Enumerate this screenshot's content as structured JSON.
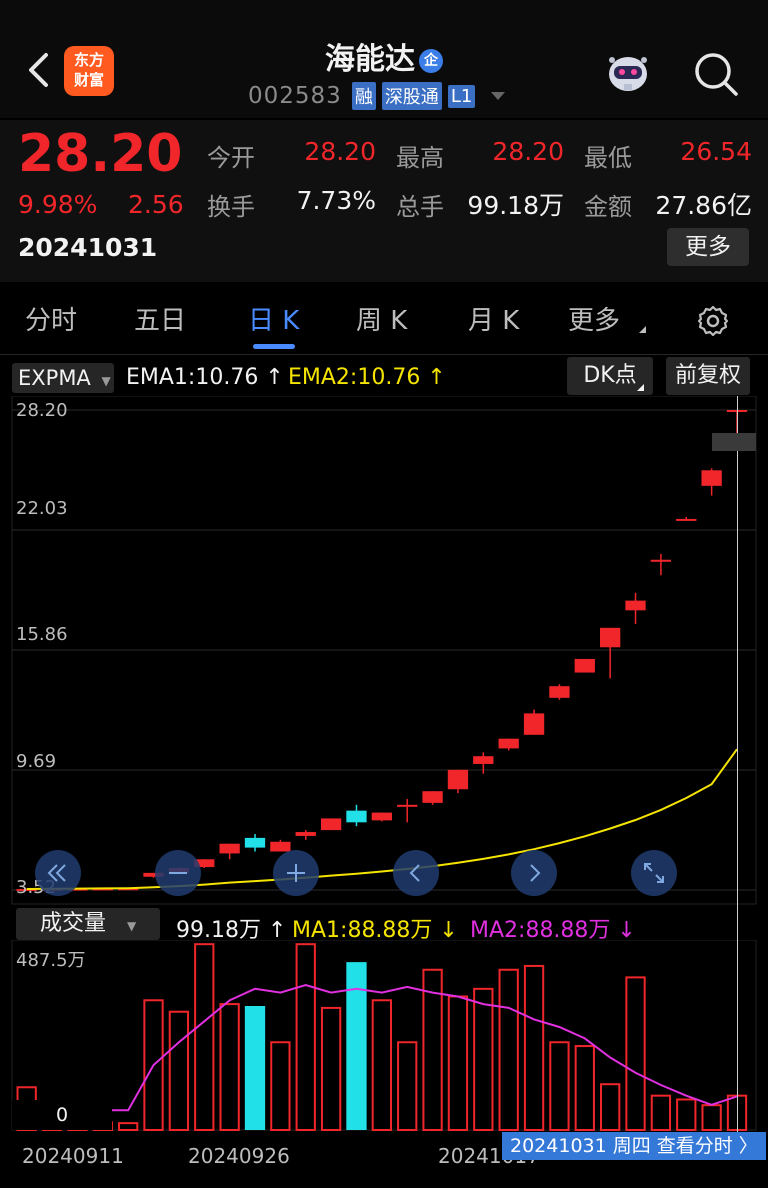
{
  "header": {
    "logo_text_1": "东方",
    "logo_text_2": "财富",
    "stock_name": "海能达",
    "qi_badge": "企",
    "stock_code": "002583",
    "tags": [
      "融",
      "深股通",
      "L1"
    ]
  },
  "quote": {
    "price": "28.20",
    "change_pct": "9.98%",
    "change": "2.56",
    "date": "20241031",
    "fields": [
      {
        "label": "今开",
        "value": "28.20",
        "color": "red"
      },
      {
        "label": "最高",
        "value": "28.20",
        "color": "red"
      },
      {
        "label": "最低",
        "value": "26.54",
        "color": "red"
      },
      {
        "label": "换手",
        "value": "7.73%",
        "color": "white"
      },
      {
        "label": "总手",
        "value": "99.18万",
        "color": "white"
      },
      {
        "label": "金额",
        "value": "27.86亿",
        "color": "white"
      }
    ],
    "more_button": "更多"
  },
  "tabs": [
    "分时",
    "五日",
    "日 K",
    "周 K",
    "月 K",
    "更多"
  ],
  "active_tab": "日 K",
  "kchart": {
    "indicator": "EXPMA",
    "ema1": "EMA1:10.76",
    "ema2": "EMA2:10.76",
    "dk_button": "DK点",
    "adjust_button": "前复权",
    "y_labels": [
      "28.20",
      "22.03",
      "15.86",
      "9.69",
      "3.52"
    ],
    "colors": {
      "up": "#f0262a",
      "down": "#22e0e8",
      "ema2": "#f5e400",
      "ma2": "#e030e0"
    }
  },
  "volume": {
    "indicator": "成交量",
    "vol": "99.18万",
    "ma1": "MA1:88.88万",
    "ma2": "MA2:88.88万",
    "top_label": "487.5万",
    "zero_label": "0"
  },
  "x_labels": [
    "20240911",
    "20240926",
    "20241017"
  ],
  "cursor_tag": "20241031 周四  查看分时",
  "chart_data": {
    "type": "candlestick",
    "ylim": [
      3.52,
      28.2
    ],
    "candles": [
      {
        "o": 3.56,
        "h": 3.58,
        "l": 3.54,
        "c": 3.57
      },
      {
        "o": 3.57,
        "h": 3.6,
        "l": 3.55,
        "c": 3.58
      },
      {
        "o": 3.58,
        "h": 3.6,
        "l": 3.56,
        "c": 3.59
      },
      {
        "o": 3.59,
        "h": 3.62,
        "l": 3.57,
        "c": 3.6
      },
      {
        "o": 3.6,
        "h": 3.62,
        "l": 3.58,
        "c": 3.61
      },
      {
        "o": 4.2,
        "h": 4.4,
        "l": 4.15,
        "c": 4.4
      },
      {
        "o": 4.4,
        "h": 4.7,
        "l": 4.35,
        "c": 4.65
      },
      {
        "o": 4.7,
        "h": 5.1,
        "l": 4.65,
        "c": 5.1
      },
      {
        "o": 5.4,
        "h": 5.9,
        "l": 5.1,
        "c": 5.9
      },
      {
        "o": 6.2,
        "h": 6.4,
        "l": 5.5,
        "c": 5.7
      },
      {
        "o": 5.5,
        "h": 6.1,
        "l": 5.5,
        "c": 6.0
      },
      {
        "o": 6.3,
        "h": 6.6,
        "l": 6.1,
        "c": 6.5
      },
      {
        "o": 6.6,
        "h": 7.2,
        "l": 6.6,
        "c": 7.2
      },
      {
        "o": 7.6,
        "h": 7.9,
        "l": 6.8,
        "c": 7.0
      },
      {
        "o": 7.1,
        "h": 7.5,
        "l": 7.05,
        "c": 7.5
      },
      {
        "o": 7.9,
        "h": 8.2,
        "l": 7.0,
        "c": 7.9
      },
      {
        "o": 8.0,
        "h": 8.6,
        "l": 7.9,
        "c": 8.6
      },
      {
        "o": 8.7,
        "h": 9.7,
        "l": 8.5,
        "c": 9.7
      },
      {
        "o": 10.0,
        "h": 10.6,
        "l": 9.5,
        "c": 10.4
      },
      {
        "o": 10.8,
        "h": 11.3,
        "l": 10.7,
        "c": 11.3
      },
      {
        "o": 11.5,
        "h": 12.8,
        "l": 11.5,
        "c": 12.6
      },
      {
        "o": 13.4,
        "h": 14.1,
        "l": 13.3,
        "c": 14.0
      },
      {
        "o": 14.7,
        "h": 15.3,
        "l": 14.7,
        "c": 15.4
      },
      {
        "o": 16.0,
        "h": 17.0,
        "l": 14.4,
        "c": 17.0
      },
      {
        "o": 17.9,
        "h": 18.8,
        "l": 17.2,
        "c": 18.4
      },
      {
        "o": 20.4,
        "h": 20.8,
        "l": 19.7,
        "c": 20.5
      },
      {
        "o": 22.6,
        "h": 22.7,
        "l": 22.5,
        "c": 22.6
      },
      {
        "o": 24.3,
        "h": 25.2,
        "l": 23.8,
        "c": 25.1
      },
      {
        "o": 28.2,
        "h": 28.2,
        "l": 26.54,
        "c": 28.2
      }
    ],
    "ema": [
      3.57,
      3.58,
      3.59,
      3.6,
      3.61,
      3.66,
      3.72,
      3.8,
      3.9,
      3.98,
      4.06,
      4.15,
      4.26,
      4.36,
      4.47,
      4.6,
      4.74,
      4.92,
      5.12,
      5.35,
      5.62,
      5.93,
      6.28,
      6.68,
      7.12,
      7.64,
      8.25,
      8.96,
      10.76
    ],
    "volume": [
      112,
      25,
      22,
      20,
      18,
      340,
      310,
      487,
      330,
      325,
      230,
      487,
      320,
      440,
      340,
      230,
      420,
      350,
      370,
      420,
      430,
      230,
      220,
      120,
      400,
      90,
      80,
      65,
      90
    ],
    "ma2": [
      48,
      50,
      52,
      52,
      52,
      170,
      230,
      285,
      340,
      370,
      360,
      380,
      360,
      370,
      360,
      375,
      360,
      350,
      330,
      320,
      290,
      270,
      240,
      190,
      150,
      118,
      90,
      66,
      88
    ]
  }
}
